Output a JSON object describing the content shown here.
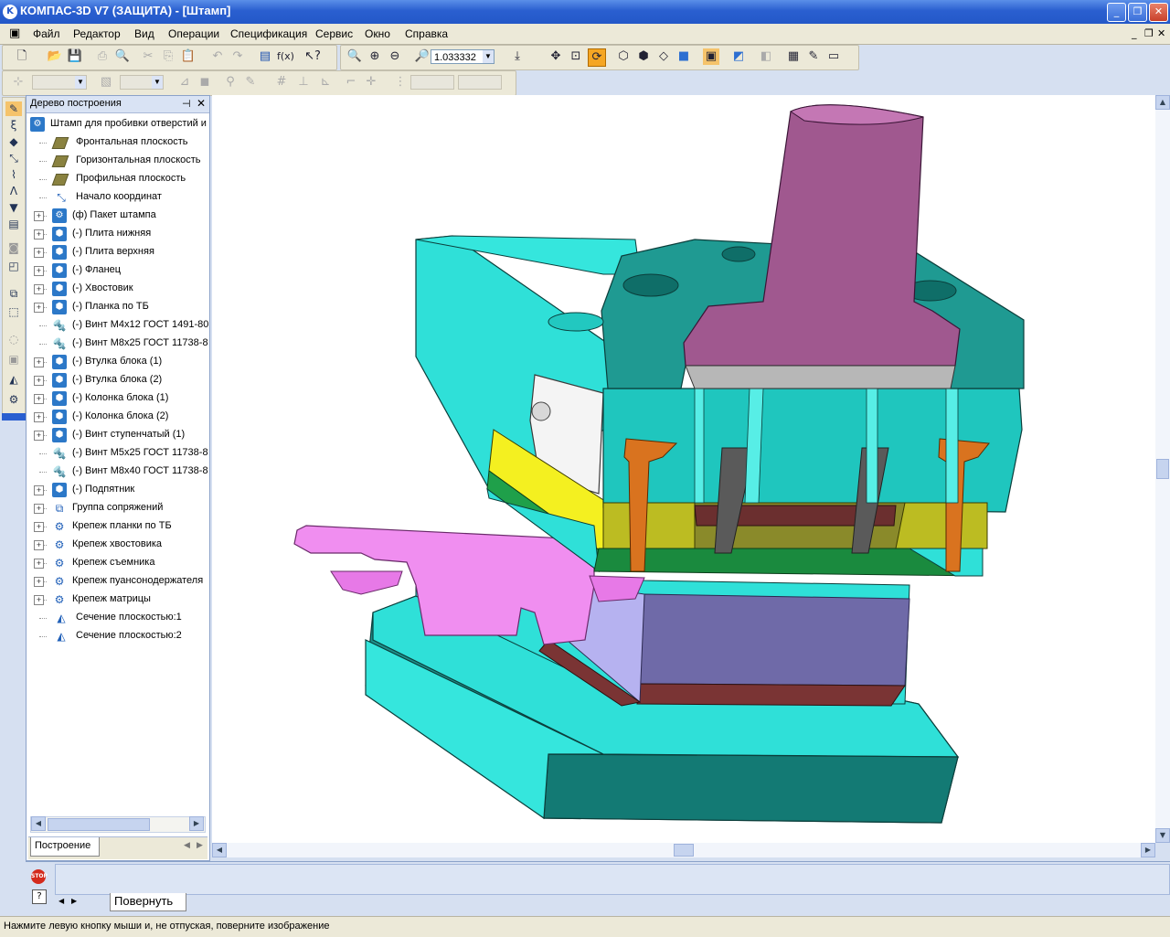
{
  "window": {
    "title": "КОМПАС-3D V7 (ЗАЩИТА) - [Штамп]",
    "app_icon": "kompas-logo-icon"
  },
  "menu": [
    {
      "label": "Файл"
    },
    {
      "label": "Редактор"
    },
    {
      "label": "Вид"
    },
    {
      "label": "Операции"
    },
    {
      "label": "Спецификация"
    },
    {
      "label": "Сервис"
    },
    {
      "label": "Окно"
    },
    {
      "label": "Справка"
    }
  ],
  "toolbar": {
    "zoom_value": "1.033332",
    "fx_label": "f(x)"
  },
  "tree": {
    "title": "Дерево построения",
    "items": [
      {
        "label": "Штамп для пробивки отверстий и",
        "icon": "assembly-icon",
        "expander": "",
        "level": 0
      },
      {
        "label": "Фронтальная плоскость",
        "icon": "plane-icon",
        "expander": "",
        "level": 1
      },
      {
        "label": "Горизонтальная плоскость",
        "icon": "plane-icon",
        "expander": "",
        "level": 1
      },
      {
        "label": "Профильная плоскость",
        "icon": "plane-icon",
        "expander": "",
        "level": 1
      },
      {
        "label": "Начало координат",
        "icon": "origin-icon",
        "expander": "",
        "level": 1
      },
      {
        "label": "(ф) Пакет штампа",
        "icon": "subassembly-icon",
        "expander": "+",
        "level": 1
      },
      {
        "label": "(-) Плита нижняя",
        "icon": "part-icon",
        "expander": "+",
        "level": 1
      },
      {
        "label": "(-) Плита верхняя",
        "icon": "part-icon",
        "expander": "+",
        "level": 1
      },
      {
        "label": "(-) Фланец",
        "icon": "part-icon",
        "expander": "+",
        "level": 1
      },
      {
        "label": "(-) Хвостовик",
        "icon": "part-icon",
        "expander": "+",
        "level": 1
      },
      {
        "label": "(-) Планка по ТБ",
        "icon": "part-icon",
        "expander": "+",
        "level": 1
      },
      {
        "label": "(-) Винт М4х12 ГОСТ 1491-80",
        "icon": "screw-icon",
        "expander": "",
        "level": 1
      },
      {
        "label": "(-) Винт М8х25 ГОСТ 11738-8",
        "icon": "screw-icon",
        "expander": "",
        "level": 1
      },
      {
        "label": "(-) Втулка блока (1)",
        "icon": "part-icon",
        "expander": "+",
        "level": 1
      },
      {
        "label": "(-) Втулка блока (2)",
        "icon": "part-icon",
        "expander": "+",
        "level": 1
      },
      {
        "label": "(-) Колонка блока (1)",
        "icon": "part-icon",
        "expander": "+",
        "level": 1
      },
      {
        "label": "(-) Колонка блока (2)",
        "icon": "part-icon",
        "expander": "+",
        "level": 1
      },
      {
        "label": "(-) Винт ступенчатый (1)",
        "icon": "part-icon",
        "expander": "+",
        "level": 1
      },
      {
        "label": "(-) Винт М5х25 ГОСТ 11738-8",
        "icon": "screw-icon",
        "expander": "",
        "level": 1
      },
      {
        "label": "(-) Винт М8х40 ГОСТ 11738-8",
        "icon": "screw-icon",
        "expander": "",
        "level": 1
      },
      {
        "label": "(-) Подпятник",
        "icon": "part-icon",
        "expander": "+",
        "level": 1
      },
      {
        "label": "Группа сопряжений",
        "icon": "mates-icon",
        "expander": "+",
        "level": 1
      },
      {
        "label": "Крепеж планки по ТБ",
        "icon": "fasteners-icon",
        "expander": "+",
        "level": 1
      },
      {
        "label": "Крепеж хвостовика",
        "icon": "fasteners-icon",
        "expander": "+",
        "level": 1
      },
      {
        "label": "Крепеж съемника",
        "icon": "fasteners-icon",
        "expander": "+",
        "level": 1
      },
      {
        "label": "Крепеж пуансонодержателя",
        "icon": "fasteners-icon",
        "expander": "+",
        "level": 1
      },
      {
        "label": "Крепеж матрицы",
        "icon": "fasteners-icon",
        "expander": "+",
        "level": 1
      },
      {
        "label": "Сечение плоскостью:1",
        "icon": "section-icon",
        "expander": "",
        "level": 1
      },
      {
        "label": "Сечение плоскостью:2",
        "icon": "section-icon",
        "expander": "",
        "level": 1
      }
    ],
    "tab_label": "Построение"
  },
  "command": {
    "tab_label": "Повернуть"
  },
  "status": {
    "text": "Нажмите левую кнопку мыши и, не отпуская, поверните изображение"
  }
}
